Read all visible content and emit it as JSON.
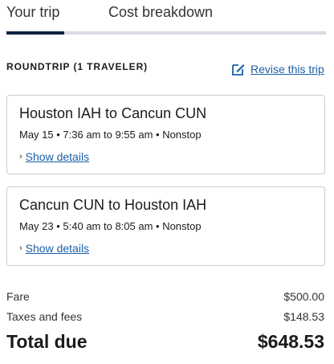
{
  "tabs": [
    {
      "label": "Your trip",
      "active": true
    },
    {
      "label": "Cost breakdown",
      "active": false
    }
  ],
  "trip": {
    "type_label": "ROUNDTRIP (1 TRAVELER)",
    "revise_label": "Revise this trip",
    "revise_icon": "edit-icon"
  },
  "flights": [
    {
      "route": "Houston IAH to Cancun CUN",
      "info": "May 15 • 7:36 am to 9:55 am • Nonstop",
      "details_label": "Show details"
    },
    {
      "route": "Cancun CUN to Houston IAH",
      "info": "May 23 • 5:40 am to 8:05 am • Nonstop",
      "details_label": "Show details"
    }
  ],
  "pricing": {
    "fare_label": "Fare",
    "fare_value": "$500.00",
    "taxes_label": "Taxes and fees",
    "taxes_value": "$148.53",
    "total_label": "Total due",
    "total_value": "$648.53"
  },
  "colors": {
    "accent_dark": "#0c2340",
    "link": "#1c5fa8",
    "border": "#c9ccd1"
  }
}
